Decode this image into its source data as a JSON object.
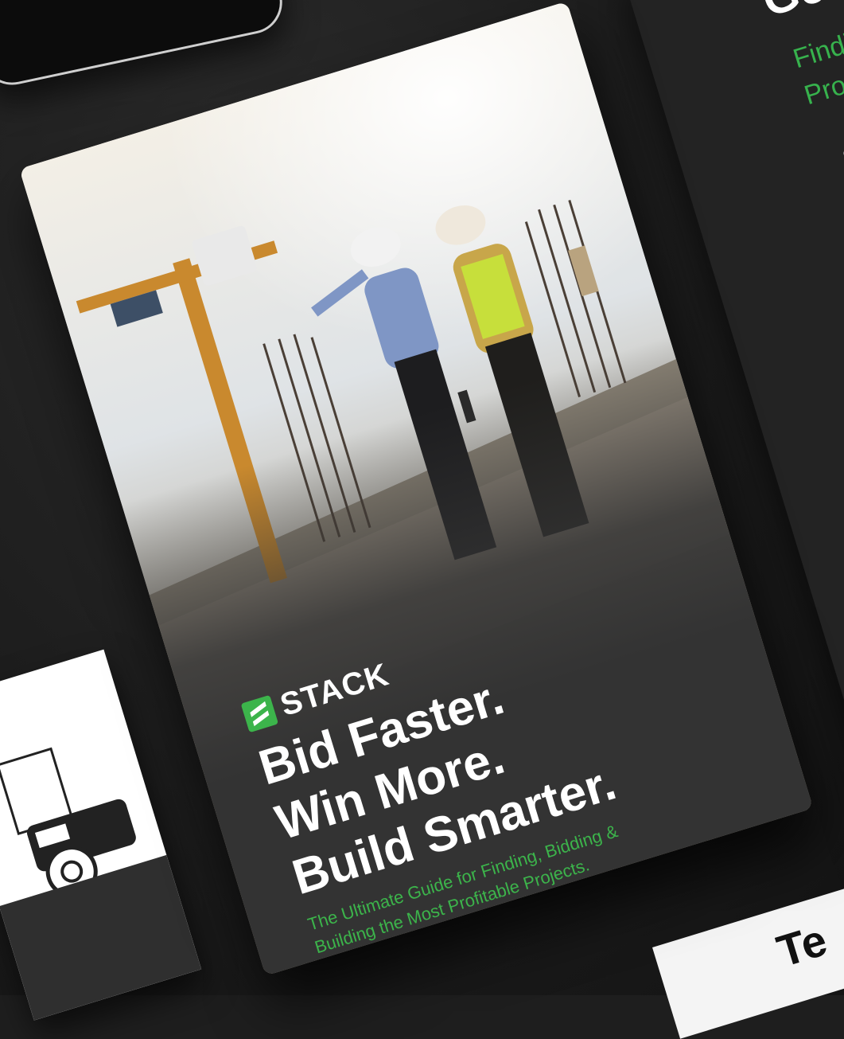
{
  "panel": {
    "title": "Get",
    "subtitle_line1": "Findin",
    "subtitle_line2": "Profi",
    "field1_text": "Fi"
  },
  "cover": {
    "brand": "STACK",
    "headline": [
      "Bid Faster.",
      "Win More.",
      "Build Smarter."
    ],
    "tagline_line1": "The Ultimate Guide for Finding, Bidding &",
    "tagline_line2": "Building the Most Profitable Projects."
  },
  "corner_item": {
    "text": "Te"
  },
  "colors": {
    "accent_green": "#3cb44b",
    "background": "#1e1e1e",
    "cover_bottom": "#333333"
  }
}
